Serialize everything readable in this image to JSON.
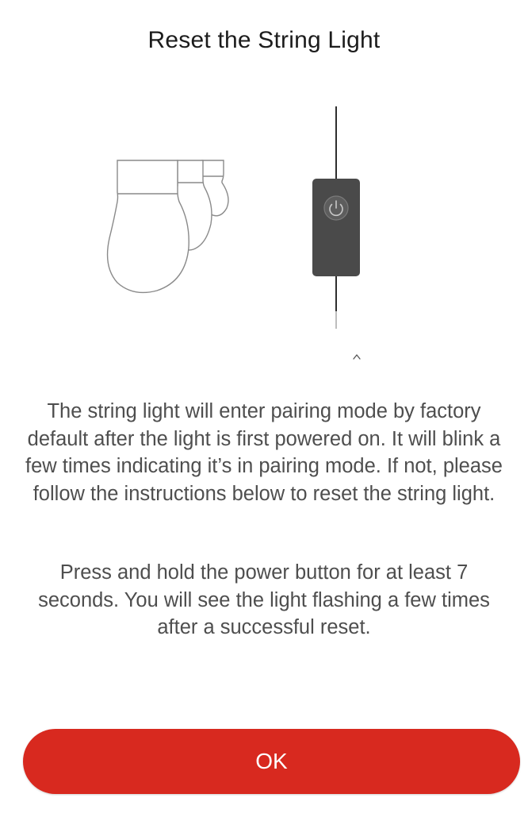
{
  "dialog": {
    "title": "Reset the String Light",
    "paragraph_1": "The string light will enter pairing mode by factory default after the light is first powered on. It will blink a few times indicating it’s in pairing mode. If not, please follow the instructions below to reset the string light.",
    "paragraph_2": "Press and hold the power button for at least 7 seconds.  You will see the light flashing a few times after a successful reset.",
    "ok_label": "OK"
  },
  "illustration": {
    "bulbs_icon": "string-light-bulbs-icon",
    "controller_icon": "power-controller-icon",
    "power_icon": "power-icon",
    "scroll_hint_icon": "chevron-up-icon"
  },
  "colors": {
    "accent": "#d8291f",
    "controller": "#4a4a4a",
    "text": "#4e4e4e",
    "title": "#1c1c1c"
  }
}
